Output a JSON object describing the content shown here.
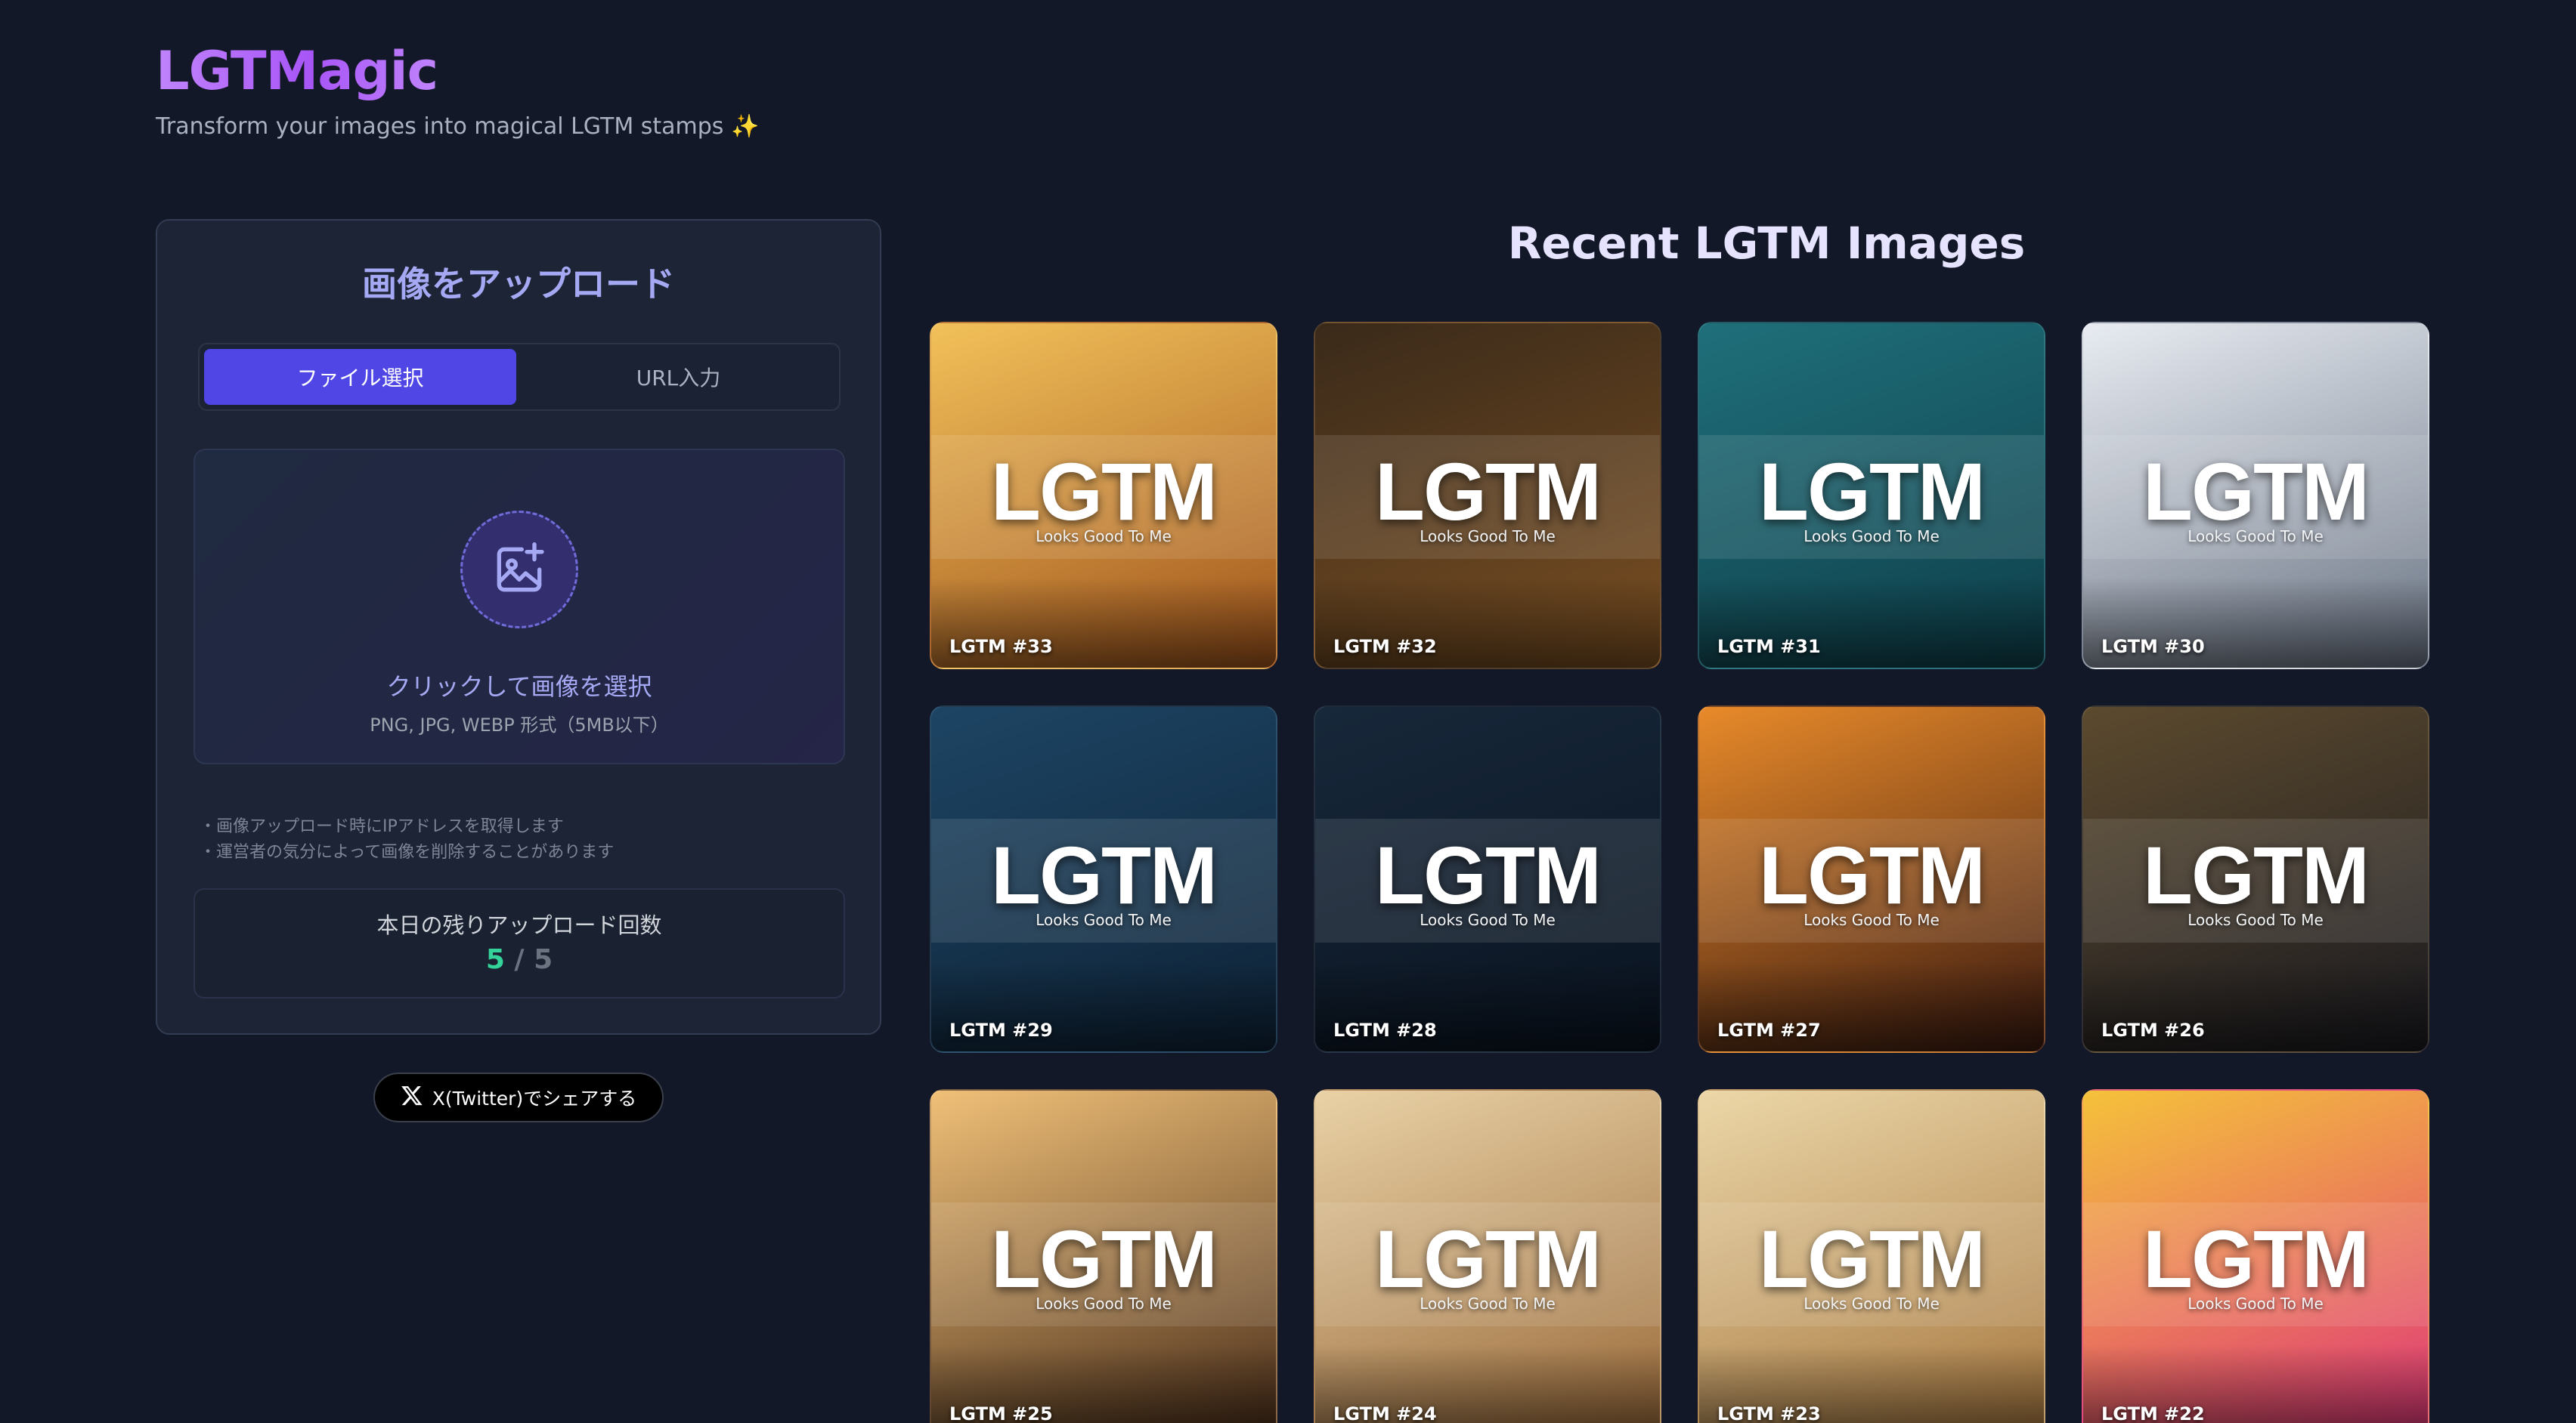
{
  "header": {
    "brand": "LGTMagic",
    "tagline": "Transform your images into magical LGTM stamps ✨"
  },
  "upload": {
    "title": "画像をアップロード",
    "tabs": [
      {
        "label": "ファイル選択",
        "active": true
      },
      {
        "label": "URL入力",
        "active": false
      }
    ],
    "dropzone": {
      "title": "クリックして画像を選択",
      "hint": "PNG, JPG, WEBP 形式（5MB以下）",
      "icon": "image-add-icon"
    },
    "notes": [
      "・画像アップロード時にIPアドレスを取得します",
      "・運営者の気分によって画像を削除することがあります"
    ],
    "remaining": {
      "label": "本日の残りアップロード回数",
      "current": "5",
      "separator": "/",
      "max": "5"
    }
  },
  "share": {
    "label": "X(Twitter)でシェアする",
    "icon": "x-logo-icon"
  },
  "gallery": {
    "title": "Recent LGTM Images",
    "overlay_text": "LGTM",
    "overlay_sub": "Looks Good To Me",
    "items": [
      {
        "label": "LGTM #33",
        "colors": [
          "#f2c15a",
          "#a0541c"
        ]
      },
      {
        "label": "LGTM #32",
        "colors": [
          "#3a2a1a",
          "#7a4f22"
        ]
      },
      {
        "label": "LGTM #31",
        "colors": [
          "#1f6f7a",
          "#0e3f4a"
        ]
      },
      {
        "label": "LGTM #30",
        "colors": [
          "#e8ecf2",
          "#6a7484"
        ]
      },
      {
        "label": "LGTM #29",
        "colors": [
          "#1d4564",
          "#0e2236"
        ]
      },
      {
        "label": "LGTM #28",
        "colors": [
          "#17283a",
          "#0a1320"
        ]
      },
      {
        "label": "LGTM #27",
        "colors": [
          "#e88a2a",
          "#3b1a10"
        ]
      },
      {
        "label": "LGTM #26",
        "colors": [
          "#5c4a2e",
          "#1a1a20"
        ]
      },
      {
        "label": "LGTM #25",
        "colors": [
          "#f0c078",
          "#4a2e1a"
        ]
      },
      {
        "label": "LGTM #24",
        "colors": [
          "#e9d2a6",
          "#9a6a3a"
        ]
      },
      {
        "label": "LGTM #23",
        "colors": [
          "#ecd7a8",
          "#a6773f"
        ]
      },
      {
        "label": "LGTM #22",
        "colors": [
          "#f5c23a",
          "#e0367a"
        ]
      }
    ]
  }
}
